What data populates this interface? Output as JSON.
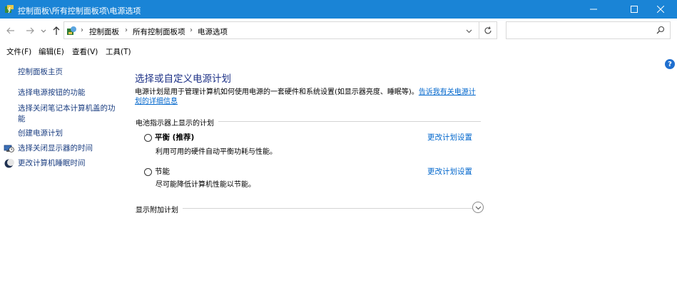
{
  "window": {
    "title": "控制面板\\所有控制面板项\\电源选项"
  },
  "address": {
    "crumbs": [
      "控制面板",
      "所有控制面板项",
      "电源选项"
    ],
    "separator": "›"
  },
  "search": {
    "value": "",
    "placeholder": ""
  },
  "menu": {
    "items": [
      "文件(F)",
      "编辑(E)",
      "查看(V)",
      "工具(T)"
    ]
  },
  "sidebar": {
    "items": [
      {
        "label": "控制面板主页",
        "icon": null
      },
      {
        "label": "选择电源按钮的功能",
        "icon": null
      },
      {
        "label": "选择关闭笔记本计算机盖的功",
        "label2": "能",
        "icon": null
      },
      {
        "label": "创建电源计划",
        "icon": null
      },
      {
        "label": "选择关闭显示器的时间",
        "icon": "monitor-clock-icon"
      },
      {
        "label": "更改计算机睡眠时间",
        "icon": "moon-icon"
      }
    ]
  },
  "main": {
    "heading": "选择或自定义电源计划",
    "description_line1": "电源计划是用于管理计算机如何使用电源的一套硬件和系统设置(如显示器亮度、睡眠等)。",
    "description_link1": "告诉我有关电源计",
    "description_link2": "划的详细信息",
    "group_label": "电池指示器上显示的计划",
    "plans": [
      {
        "name": "平衡 (推荐)",
        "desc": "利用可用的硬件自动平衡功耗与性能。",
        "link": "更改计划设置",
        "selected": false
      },
      {
        "name": "节能",
        "desc": "尽可能降低计算机性能以节能。",
        "link": "更改计划设置",
        "selected": false
      }
    ],
    "extra_label": "显示附加计划"
  },
  "help": {
    "label": "?"
  },
  "colors": {
    "titlebar": "#1a84d6",
    "link": "#0066cc",
    "heading": "#1e3287"
  }
}
